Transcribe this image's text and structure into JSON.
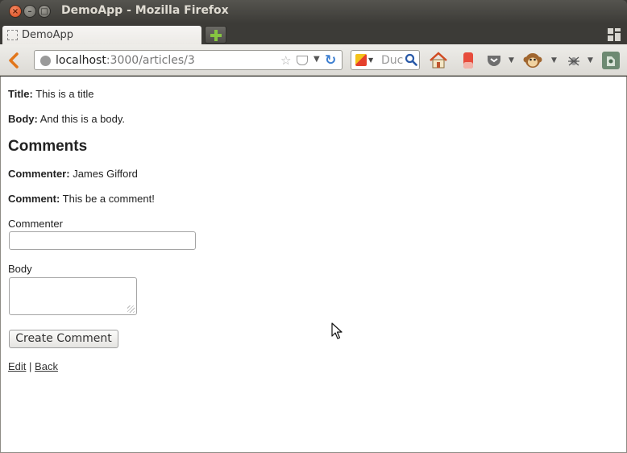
{
  "window": {
    "title": "DemoApp - Mozilla Firefox",
    "close_glyph": "×",
    "minimize_glyph": "–",
    "maximize_glyph": "□"
  },
  "tabs": [
    {
      "title": "DemoApp",
      "active": true
    }
  ],
  "navbar": {
    "url_host": "localhost",
    "url_rest": ":3000/articles/3",
    "search_placeholder": "Duck",
    "icons": [
      "back-icon",
      "globe-icon",
      "bookmark-star-icon",
      "pocket-icon",
      "reload-icon",
      "search-engine-icon",
      "search-icon",
      "home-icon",
      "eraser-icon",
      "pocket-toolbar-icon",
      "monkey-icon",
      "bug-icon",
      "evernote-icon"
    ]
  },
  "article": {
    "title_label": "Title:",
    "title_value": "This is a title",
    "body_label": "Body:",
    "body_value": "And this is a body."
  },
  "comments": {
    "heading": "Comments",
    "items": [
      {
        "commenter_label": "Commenter:",
        "commenter_value": "James Gifford",
        "comment_label": "Comment:",
        "comment_value": "This be a comment!"
      }
    ]
  },
  "form": {
    "commenter_label": "Commenter",
    "commenter_value": "",
    "body_label": "Body",
    "body_value": "",
    "submit_label": "Create Comment"
  },
  "links": {
    "edit": "Edit",
    "separator": "|",
    "back": "Back"
  },
  "colors": {
    "titlebar": "#3c3b37",
    "close_button": "#e65c2f",
    "newtab_plus": "#86c541",
    "reload": "#3d7fd1"
  }
}
